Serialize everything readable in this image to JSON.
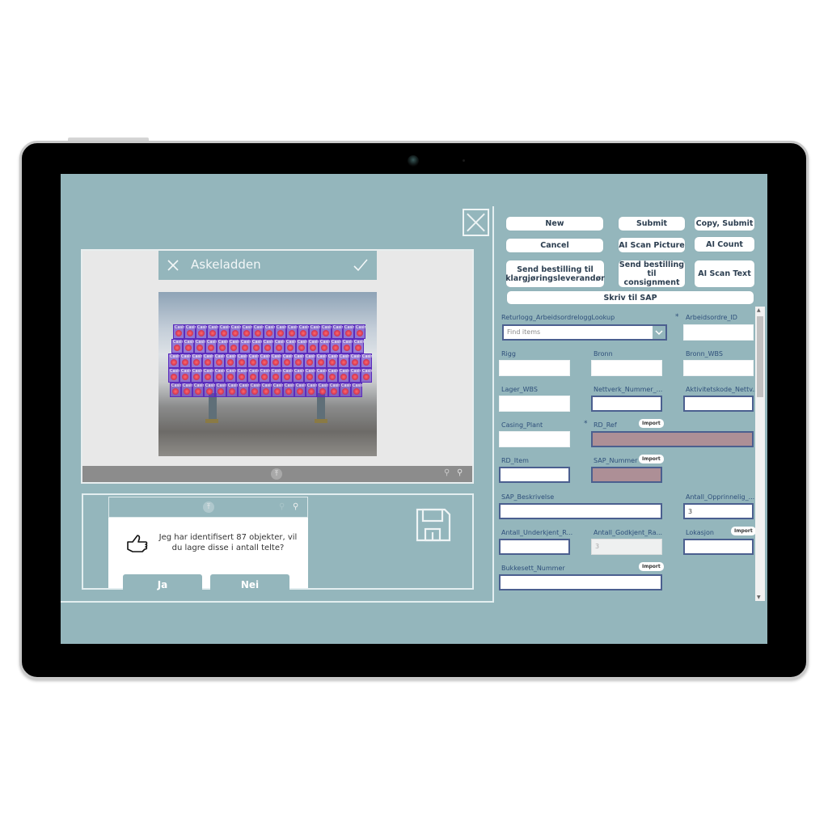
{
  "app": {
    "camera_dialog": {
      "title": "Askeladden",
      "close_icon": "close-icon",
      "confirm_icon": "check-icon",
      "detection_label": "Casing_..."
    },
    "confirm_dialog": {
      "message": "Jeg har identifisert 87 objekter, vil du lagre disse i antall telte?",
      "yes_label": "Ja",
      "no_label": "Nei",
      "icon": "thumbs-up-icon"
    },
    "toolbar_buttons": {
      "new": "New",
      "submit": "Submit",
      "copy_submit": "Copy, Submit",
      "cancel": "Cancel",
      "ai_scan_picture": "AI Scan Picture",
      "ai_count": "AI Count",
      "send_klargjoring": "Send bestilling til klargjøringsleverandør",
      "send_consignment": "Send bestilling til consignment",
      "ai_scan_text": "AI Scan Text",
      "skriv_sap": "Skriv til SAP"
    },
    "form": {
      "lookup_label": "Returlogg_ArbeidsordreloggLookup",
      "lookup_placeholder": "Find items",
      "required_marker": "*",
      "import_label": "Import",
      "fields": {
        "arbeidsordre_id": {
          "label": "Arbeidsordre_ID",
          "value": ""
        },
        "rigg": {
          "label": "Rigg",
          "value": ""
        },
        "bronn": {
          "label": "Bronn",
          "value": ""
        },
        "bronn_wbs": {
          "label": "Bronn_WBS",
          "value": ""
        },
        "lager_wbs": {
          "label": "Lager_WBS",
          "value": ""
        },
        "nettverk_nummer": {
          "label": "Nettverk_Nummer_...",
          "value": ""
        },
        "aktivitetskode": {
          "label": "Aktivitetskode_Nettv...",
          "value": ""
        },
        "casing_plant": {
          "label": "Casing_Plant",
          "value": ""
        },
        "rd_ref": {
          "label": "RD_Ref",
          "value": ""
        },
        "rd_item": {
          "label": "RD_Item",
          "value": ""
        },
        "sap_nummer": {
          "label": "SAP_Nummer",
          "value": ""
        },
        "sap_beskrivelse": {
          "label": "SAP_Beskrivelse",
          "value": ""
        },
        "antall_opprinnelig": {
          "label": "Antall_Opprinnelig_...",
          "value": "3"
        },
        "antall_underkjent": {
          "label": "Antall_Underkjent_R...",
          "value": ""
        },
        "antall_godkjent": {
          "label": "Antall_Godkjent_Ra...",
          "value": "3"
        },
        "lokasjon": {
          "label": "Lokasjon",
          "value": ""
        },
        "bukkesett_nummer": {
          "label": "Bukkesett_Nummer",
          "value": ""
        }
      }
    },
    "colors": {
      "background": "#94b6bc",
      "label": "#2e4f7a",
      "invalid_field": "#ad8f96",
      "focus_border": "#4b5f8f"
    }
  }
}
